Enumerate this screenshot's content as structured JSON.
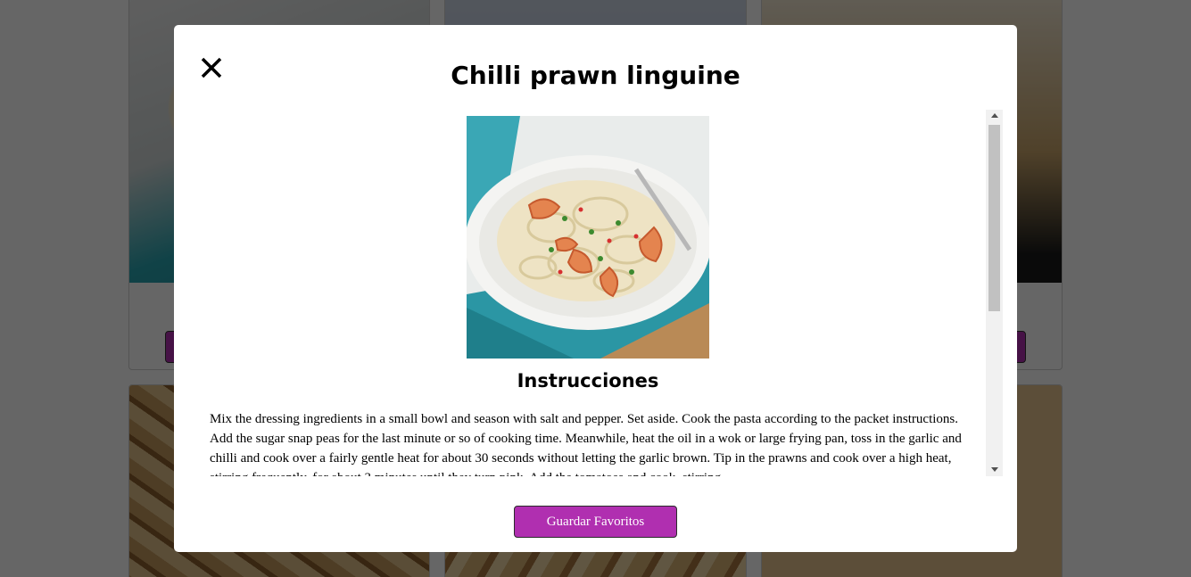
{
  "modal": {
    "title": "Chilli prawn linguine",
    "close_icon": "close-icon",
    "image_alt": "Chilli prawn linguine photo",
    "section_title": "Instrucciones",
    "instructions": "Mix the dressing ingredients in a small bowl and season with salt and pepper. Set aside. Cook the pasta according to the packet instructions. Add the sugar snap peas for the last minute or so of cooking time. Meanwhile, heat the oil in a wok or large frying pan, toss in the garlic and chilli and cook over a fairly gentle heat for about 30 seconds without letting the garlic brown. Tip in the prawns and cook over a high heat, stirring frequently, for about 3 minutes until they turn pink. Add the tomatoes and cook, stirring",
    "save_button_label": "Guardar Favoritos"
  },
  "colors": {
    "accent": "#b02fb0",
    "overlay": "rgba(0,0,0,0.6)",
    "scrollbar_track": "#f1f1f1",
    "scrollbar_thumb": "#c1c1c1"
  },
  "scroll": {
    "position_fraction": 0.0,
    "visible_fraction": 0.52
  }
}
